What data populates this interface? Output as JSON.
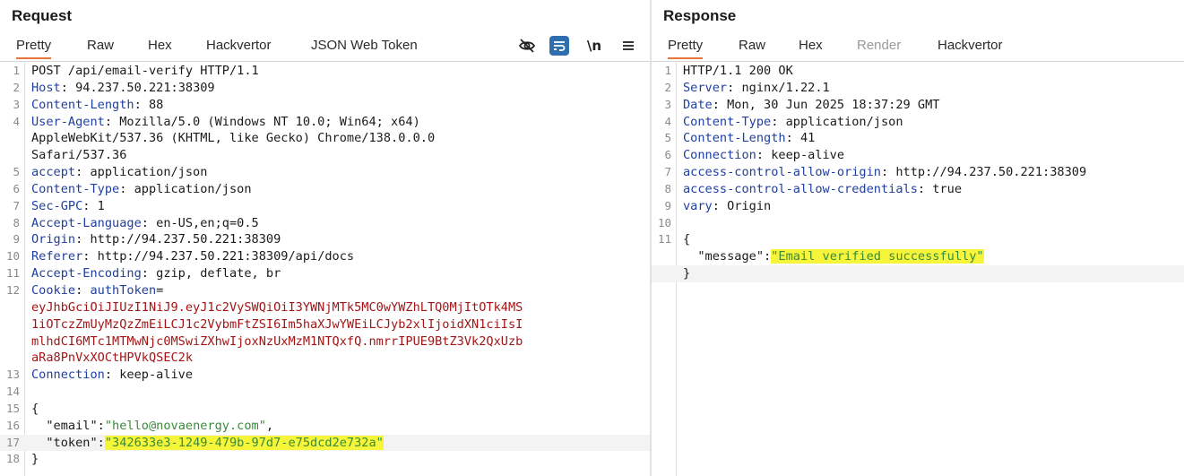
{
  "request": {
    "title": "Request",
    "tabs": [
      "Pretty",
      "Raw",
      "Hex",
      "Hackvertor",
      "JSON Web Token"
    ],
    "active_tab": "Pretty",
    "toolbar": {
      "newline_label": "\\n"
    },
    "lines": [
      {
        "n": "1",
        "parts": [
          {
            "t": "POST /api/email-verify HTTP/1.1",
            "c": ""
          }
        ]
      },
      {
        "n": "2",
        "parts": [
          {
            "t": "Host",
            "c": "hk"
          },
          {
            "t": ": 94.237.50.221:38309",
            "c": ""
          }
        ]
      },
      {
        "n": "3",
        "parts": [
          {
            "t": "Content-Length",
            "c": "hk"
          },
          {
            "t": ": 88",
            "c": ""
          }
        ]
      },
      {
        "n": "4",
        "parts": [
          {
            "t": "User-Agent",
            "c": "hk"
          },
          {
            "t": ": Mozilla/5.0 (Windows NT 10.0; Win64; x64)",
            "c": ""
          }
        ]
      },
      {
        "n": "",
        "parts": [
          {
            "t": "AppleWebKit/537.36 (KHTML, like Gecko) Chrome/138.0.0.0",
            "c": ""
          }
        ]
      },
      {
        "n": "",
        "parts": [
          {
            "t": "Safari/537.36",
            "c": ""
          }
        ]
      },
      {
        "n": "5",
        "parts": [
          {
            "t": "accept",
            "c": "hk"
          },
          {
            "t": ": application/json",
            "c": ""
          }
        ]
      },
      {
        "n": "6",
        "parts": [
          {
            "t": "Content-Type",
            "c": "hk"
          },
          {
            "t": ": application/json",
            "c": ""
          }
        ]
      },
      {
        "n": "7",
        "parts": [
          {
            "t": "Sec-GPC",
            "c": "hk"
          },
          {
            "t": ": 1",
            "c": ""
          }
        ]
      },
      {
        "n": "8",
        "parts": [
          {
            "t": "Accept-Language",
            "c": "hk"
          },
          {
            "t": ": en-US,en;q=0.5",
            "c": ""
          }
        ]
      },
      {
        "n": "9",
        "parts": [
          {
            "t": "Origin",
            "c": "hk"
          },
          {
            "t": ": http://94.237.50.221:38309",
            "c": ""
          }
        ]
      },
      {
        "n": "10",
        "parts": [
          {
            "t": "Referer",
            "c": "hk"
          },
          {
            "t": ": http://94.237.50.221:38309/api/docs",
            "c": ""
          }
        ]
      },
      {
        "n": "11",
        "parts": [
          {
            "t": "Accept-Encoding",
            "c": "hk"
          },
          {
            "t": ": gzip, deflate, br",
            "c": ""
          }
        ]
      },
      {
        "n": "12",
        "parts": [
          {
            "t": "Cookie",
            "c": "hk"
          },
          {
            "t": ": ",
            "c": ""
          },
          {
            "t": "authToken",
            "c": "hk"
          },
          {
            "t": "=",
            "c": ""
          }
        ]
      },
      {
        "n": "",
        "parts": [
          {
            "t": "eyJhbGciOiJIUzI1NiJ9.eyJ1c2VySWQiOiI3YWNjMTk5MC0wYWZhLTQ0MjItOTk4MS",
            "c": "ck"
          }
        ]
      },
      {
        "n": "",
        "parts": [
          {
            "t": "1iOTczZmUyMzQzZmEiLCJ1c2VybmFtZSI6Im5haXJwYWEiLCJyb2xlIjoidXN1ciIsI",
            "c": "ck"
          }
        ]
      },
      {
        "n": "",
        "parts": [
          {
            "t": "mlhdCI6MTc1MTMwNjc0MSwiZXhwIjoxNzUxMzM1NTQxfQ.nmrrIPUE9BtZ3Vk2QxUzb",
            "c": "ck"
          }
        ]
      },
      {
        "n": "",
        "parts": [
          {
            "t": "aRa8PnVxXOCtHPVkQSEC2k",
            "c": "ck"
          }
        ]
      },
      {
        "n": "13",
        "parts": [
          {
            "t": "Connection",
            "c": "hk"
          },
          {
            "t": ": keep-alive",
            "c": ""
          }
        ]
      },
      {
        "n": "14",
        "parts": [
          {
            "t": "",
            "c": ""
          }
        ]
      },
      {
        "n": "15",
        "parts": [
          {
            "t": "{",
            "c": ""
          }
        ]
      },
      {
        "n": "16",
        "parts": [
          {
            "t": "  \"email\"",
            "c": "jk"
          },
          {
            "t": ":",
            "c": ""
          },
          {
            "t": "\"hello@novaenergy.com\"",
            "c": "js"
          },
          {
            "t": ",",
            "c": ""
          }
        ]
      },
      {
        "n": "17",
        "hl": true,
        "parts": [
          {
            "t": "  \"token\"",
            "c": "jk"
          },
          {
            "t": ":",
            "c": ""
          },
          {
            "t": "\"342633e3-1249-479b-97d7-e75dcd2e732a\"",
            "c": "js mark"
          }
        ]
      },
      {
        "n": "18",
        "parts": [
          {
            "t": "}",
            "c": ""
          }
        ]
      }
    ]
  },
  "response": {
    "title": "Response",
    "tabs": [
      "Pretty",
      "Raw",
      "Hex",
      "Render",
      "Hackvertor"
    ],
    "active_tab": "Pretty",
    "disabled_tab": "Render",
    "lines": [
      {
        "n": "1",
        "parts": [
          {
            "t": "HTTP/1.1 200 OK",
            "c": ""
          }
        ]
      },
      {
        "n": "2",
        "parts": [
          {
            "t": "Server",
            "c": "hk"
          },
          {
            "t": ": nginx/1.22.1",
            "c": ""
          }
        ]
      },
      {
        "n": "3",
        "parts": [
          {
            "t": "Date",
            "c": "hk"
          },
          {
            "t": ": Mon, 30 Jun 2025 18:37:29 GMT",
            "c": ""
          }
        ]
      },
      {
        "n": "4",
        "parts": [
          {
            "t": "Content-Type",
            "c": "hk"
          },
          {
            "t": ": application/json",
            "c": ""
          }
        ]
      },
      {
        "n": "5",
        "parts": [
          {
            "t": "Content-Length",
            "c": "hk"
          },
          {
            "t": ": 41",
            "c": ""
          }
        ]
      },
      {
        "n": "6",
        "parts": [
          {
            "t": "Connection",
            "c": "hk"
          },
          {
            "t": ": keep-alive",
            "c": ""
          }
        ]
      },
      {
        "n": "7",
        "parts": [
          {
            "t": "access-control-allow-origin",
            "c": "hk"
          },
          {
            "t": ": http://94.237.50.221:38309",
            "c": ""
          }
        ]
      },
      {
        "n": "8",
        "parts": [
          {
            "t": "access-control-allow-credentials",
            "c": "hk"
          },
          {
            "t": ": true",
            "c": ""
          }
        ]
      },
      {
        "n": "9",
        "parts": [
          {
            "t": "vary",
            "c": "hk"
          },
          {
            "t": ": Origin",
            "c": ""
          }
        ]
      },
      {
        "n": "10",
        "parts": [
          {
            "t": "",
            "c": ""
          }
        ]
      },
      {
        "n": "11",
        "parts": [
          {
            "t": "{",
            "c": ""
          }
        ]
      },
      {
        "n": "",
        "parts": [
          {
            "t": "  \"message\"",
            "c": "jk"
          },
          {
            "t": ":",
            "c": ""
          },
          {
            "t": "\"Email verified successfully\"",
            "c": "js mark"
          }
        ]
      },
      {
        "n": "",
        "hl": true,
        "parts": [
          {
            "t": "}",
            "c": ""
          }
        ]
      }
    ]
  },
  "colors": {
    "active_tab_underline": "#e8763a",
    "header_key": "#1f3fa0",
    "cookie_value": "#a31515",
    "json_string": "#3a8a3a",
    "highlight": "#f6f53a",
    "wrap_button": "#2f6fad"
  },
  "icons": [
    "hide-icon",
    "wrap-lines-icon",
    "newline-toggle-icon",
    "menu-icon"
  ]
}
